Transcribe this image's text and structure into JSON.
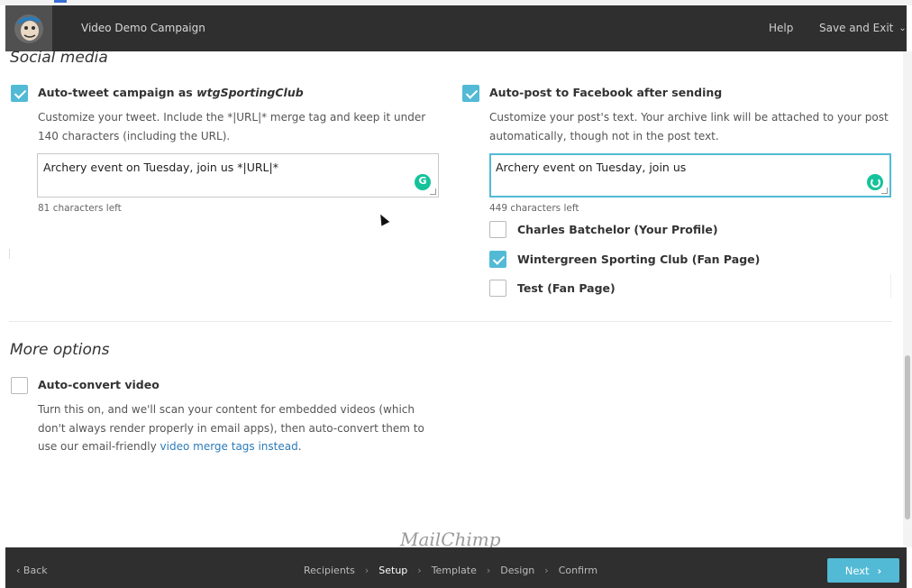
{
  "header": {
    "campaign_title": "Video Demo Campaign",
    "help": "Help",
    "save_exit": "Save and Exit"
  },
  "social": {
    "title": "Social media",
    "twitter": {
      "checked": true,
      "label_prefix": "Auto-tweet campaign as ",
      "account": "wtgSportingClub",
      "description": "Customize your tweet. Include the *|URL|* merge tag and keep it under 140 characters (including the URL).",
      "value": "Archery event on Tuesday, join us *|URL|*",
      "counter": "81 characters left"
    },
    "facebook": {
      "checked": true,
      "label": "Auto-post to Facebook after sending",
      "description": "Customize your post's text. Your archive link will be attached to your post automatically, though not in the post text.",
      "value": "Archery event on Tuesday, join us",
      "counter": "449 characters left",
      "pages": [
        {
          "label": "Charles Batchelor (Your Profile)",
          "checked": false
        },
        {
          "label": "Wintergreen Sporting Club (Fan Page)",
          "checked": true
        },
        {
          "label": "Test (Fan Page)",
          "checked": false
        }
      ]
    }
  },
  "more": {
    "title": "More options",
    "auto_convert": {
      "checked": false,
      "label": "Auto-convert video",
      "description_prefix": "Turn this on, and we'll scan your content for embedded videos (which don't always render properly in email apps), then auto-convert them to use our email-friendly ",
      "link": "video merge tags instead",
      "description_suffix": "."
    }
  },
  "watermark": "MailChimp",
  "footer": {
    "back": "Back",
    "steps": [
      "Recipients",
      "Setup",
      "Template",
      "Design",
      "Confirm"
    ],
    "active_step": "Setup",
    "next": "Next"
  },
  "colors": {
    "accent": "#52bad5",
    "topbar": "#2f2f2f",
    "link": "#2b7bb9",
    "grammarly": "#15c39a"
  },
  "icons": [
    "mailchimp-logo-icon",
    "chevron-down-icon",
    "checkmark-icon",
    "grammarly-icon",
    "chevron-left-icon",
    "chevron-right-icon",
    "mouse-cursor-icon"
  ]
}
